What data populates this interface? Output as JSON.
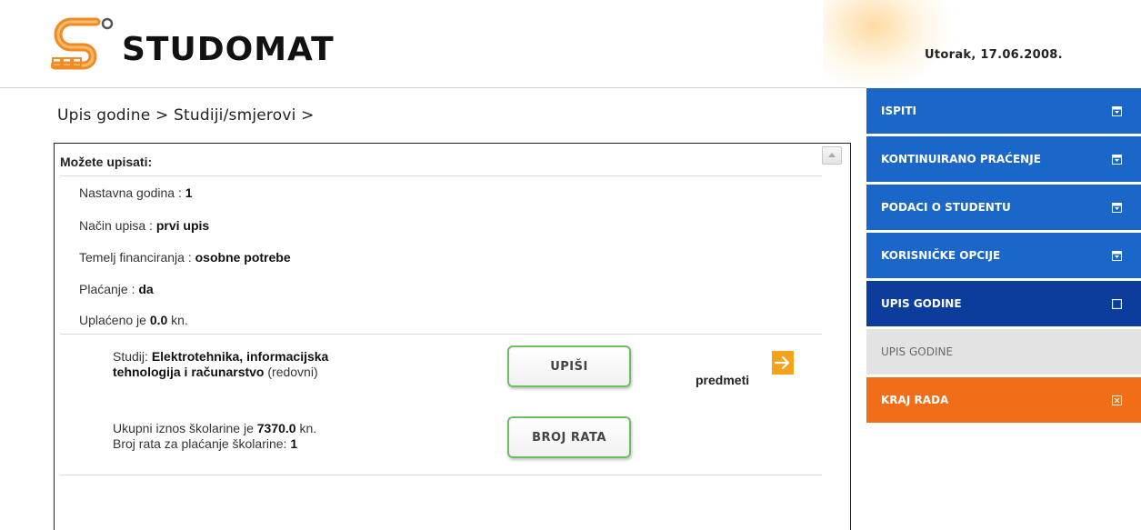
{
  "header": {
    "logo_text": "STUDOMAT",
    "date": "Utorak, 17.06.2008."
  },
  "breadcrumb": "Upis godine > Studiji/smjerovi >",
  "panel": {
    "title": "Možete upisati:",
    "fields": [
      {
        "label": "Nastavna godina : ",
        "value": "1",
        "suffix": ""
      },
      {
        "label": "Način upisa : ",
        "value": "prvi upis",
        "suffix": ""
      },
      {
        "label": "Temelj financiranja : ",
        "value": "osobne potrebe",
        "suffix": ""
      },
      {
        "label": "Plaćanje : ",
        "value": "da",
        "suffix": ""
      },
      {
        "label": "Uplaćeno je ",
        "value": "0.0",
        "suffix": " kn."
      }
    ],
    "study": {
      "label": "Studij: ",
      "name_line1": "Elektrotehnika, informacijska",
      "name_line2": "tehnologija i računarstvo",
      "mode": " (redovni)"
    },
    "enroll_button": "UPIŠI",
    "subjects_label": "predmeti",
    "fees": {
      "line1_prefix": "Ukupni iznos školarine je ",
      "line1_value": "7370.0",
      "line1_suffix": " kn.",
      "line2_prefix": "Broj rata za plaćanje školarine: ",
      "line2_value": "1"
    },
    "installments_button": "BROJ RATA"
  },
  "menu": {
    "items": [
      {
        "label": "ISPITI",
        "style": "blue",
        "icon": "expand-icon"
      },
      {
        "label": "KONTINUIRANO PRAĆENJE",
        "style": "blue",
        "icon": "expand-icon"
      },
      {
        "label": "PODACI O STUDENTU",
        "style": "blue",
        "icon": "expand-icon"
      },
      {
        "label": "KORISNIČKE OPCIJE",
        "style": "blue",
        "icon": "expand-icon"
      },
      {
        "label": "UPIS GODINE",
        "style": "dark",
        "icon": "collapse-icon"
      },
      {
        "label": "UPIS GODINE",
        "style": "grey",
        "icon": ""
      },
      {
        "label": "KRAJ RADA",
        "style": "orange",
        "icon": "close-box-icon"
      }
    ]
  },
  "colors": {
    "menu_blue": "#1a67c9",
    "menu_dark": "#0c3d9c",
    "menu_orange": "#f26d17",
    "button_border": "#6bbf5e",
    "arrow_orange": "#f5a21a"
  }
}
